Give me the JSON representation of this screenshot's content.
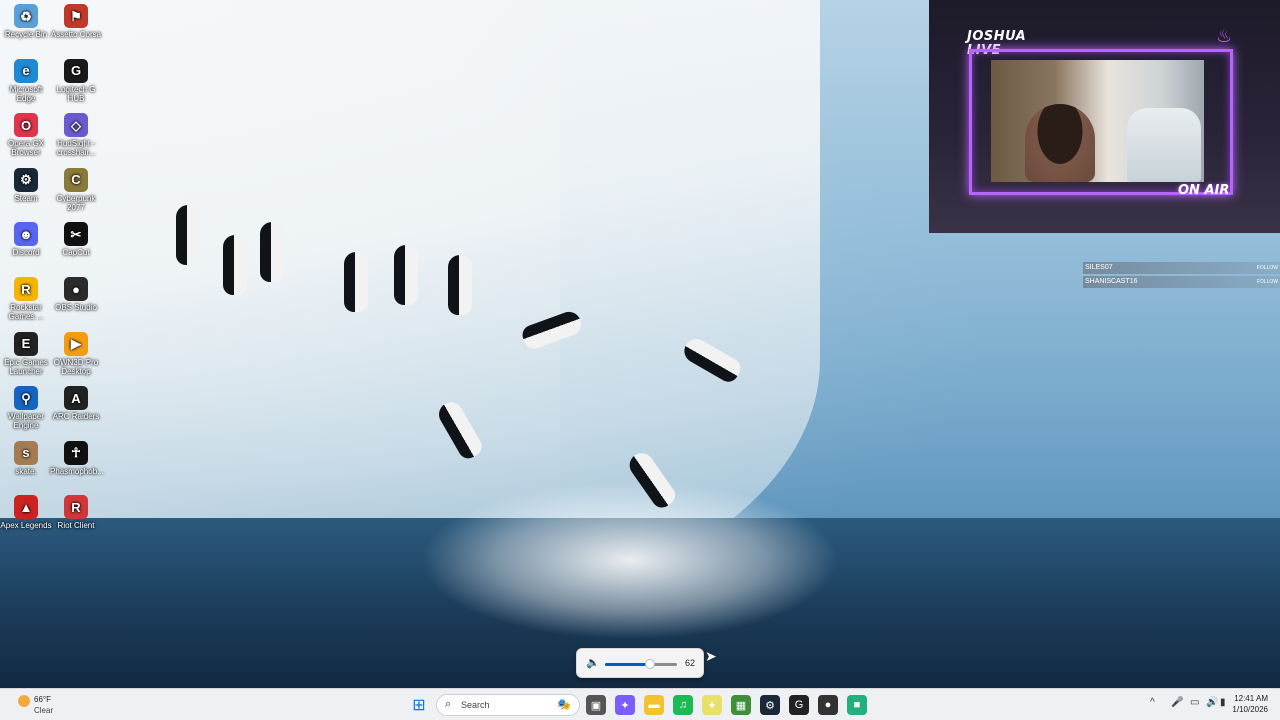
{
  "desktop_icons": [
    {
      "label": "Recycle Bin",
      "glyph": "♻",
      "color": "#5aa0d8"
    },
    {
      "label": "Assetto Corsa",
      "glyph": "⚑",
      "color": "#c0392b"
    },
    {
      "label": "Microsoft Edge",
      "glyph": "e",
      "color": "#1f8ad2"
    },
    {
      "label": "Logitech G HUB",
      "glyph": "G",
      "color": "#1a1a1a"
    },
    {
      "label": "Opera GX Browser",
      "glyph": "O",
      "color": "#e0344b"
    },
    {
      "label": "HudSight - crosshair...",
      "glyph": "◇",
      "color": "#6a5acd"
    },
    {
      "label": "Steam",
      "glyph": "⚙",
      "color": "#1b2838"
    },
    {
      "label": "Cyberpunk 2077",
      "glyph": "C",
      "color": "#8a7a3a"
    },
    {
      "label": "Discord",
      "glyph": "☻",
      "color": "#5865f2"
    },
    {
      "label": "CapCut",
      "glyph": "✂",
      "color": "#111111"
    },
    {
      "label": "Rockstar Games ...",
      "glyph": "R",
      "color": "#f4b400"
    },
    {
      "label": "OBS Studio",
      "glyph": "●",
      "color": "#2b2b2b"
    },
    {
      "label": "Epic Games Launcher",
      "glyph": "E",
      "color": "#222222"
    },
    {
      "label": "OWN3D Pro Desktop",
      "glyph": "▶",
      "color": "#f39c12"
    },
    {
      "label": "Wallpaper Engine",
      "glyph": "⚲",
      "color": "#1565c0"
    },
    {
      "label": "ARC Raiders",
      "glyph": "A",
      "color": "#222222"
    },
    {
      "label": "skate.",
      "glyph": "s",
      "color": "#a57c52"
    },
    {
      "label": "Phasmophob...",
      "glyph": "☥",
      "color": "#111111"
    },
    {
      "label": "Apex Legends",
      "glyph": "▲",
      "color": "#cc2222"
    },
    {
      "label": "Riot Client",
      "glyph": "R",
      "color": "#d13639"
    }
  ],
  "stream_overlay": {
    "brand_line1": "JOSHUA",
    "brand_line2": "LIVE",
    "on_air": "ON AIR",
    "accent": "#b865ff"
  },
  "follows": [
    {
      "name": "SILES07",
      "tag": "FOLLOW"
    },
    {
      "name": "SHANISCAST16",
      "tag": "FOLLOW"
    }
  ],
  "volume": {
    "value": "62",
    "level": 0.62,
    "icon": "speaker-icon"
  },
  "taskbar": {
    "weather_temp": "66°F",
    "weather_cond": "Clear",
    "search_placeholder": "Search",
    "time": "12:41 AM",
    "date": "1/10/2026",
    "apps": [
      {
        "name": "start-button",
        "glyph": "⊞",
        "color": "#0a74d8"
      },
      {
        "name": "task-view",
        "glyph": "▣",
        "color": "#555555"
      },
      {
        "name": "copilot",
        "glyph": "✦",
        "color": "#7b5cff"
      },
      {
        "name": "file-explorer",
        "glyph": "▬",
        "color": "#f2c230"
      },
      {
        "name": "spotify",
        "glyph": "♫",
        "color": "#1db954"
      },
      {
        "name": "app-yellow",
        "glyph": "✦",
        "color": "#e7e069"
      },
      {
        "name": "minecraft",
        "glyph": "▦",
        "color": "#3f8f3a"
      },
      {
        "name": "steam",
        "glyph": "⚙",
        "color": "#1b2838"
      },
      {
        "name": "g-hub",
        "glyph": "G",
        "color": "#222222"
      },
      {
        "name": "obs",
        "glyph": "●",
        "color": "#333333"
      },
      {
        "name": "green-app",
        "glyph": "■",
        "color": "#22b07d"
      }
    ],
    "tray": [
      "^",
      "🎤",
      "▭",
      "🔊",
      "🔋"
    ]
  }
}
